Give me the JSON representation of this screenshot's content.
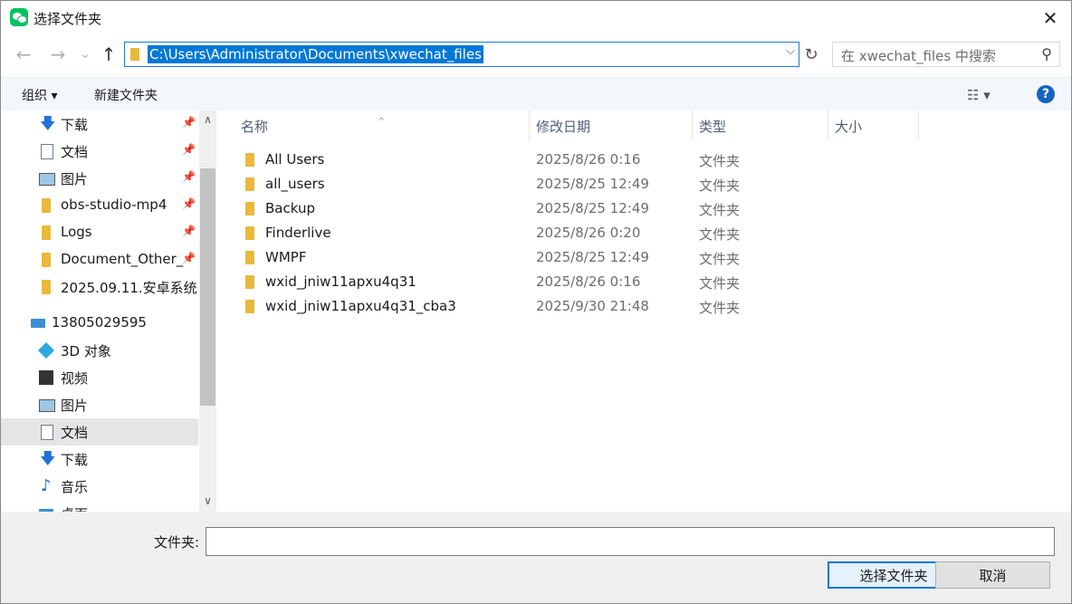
{
  "window": {
    "title": "选择文件夹",
    "close": "✕"
  },
  "nav": {
    "back": "←",
    "forward": "→",
    "recent": "⌄",
    "up": "↑"
  },
  "address": {
    "path": "C:\\Users\\Administrator\\Documents\\xwechat_files",
    "dropdown": "⌵",
    "refresh": "↻"
  },
  "search": {
    "placeholder": "在 xwechat_files 中搜索",
    "icon": "⚲"
  },
  "toolbar": {
    "organize": "组织 ▾",
    "new_folder": "新建文件夹",
    "view": "☷ ▾",
    "help": "?"
  },
  "sidebar": {
    "items": [
      {
        "label": "下载",
        "icon": "download-icon",
        "pinned": true
      },
      {
        "label": "文档",
        "icon": "document-icon",
        "pinned": true
      },
      {
        "label": "图片",
        "icon": "picture-icon",
        "pinned": true
      },
      {
        "label": "obs-studio-mp4",
        "icon": "folder-icon",
        "pinned": true
      },
      {
        "label": "Logs",
        "icon": "folder-icon",
        "pinned": true
      },
      {
        "label": "Document_Other_",
        "icon": "folder-icon",
        "pinned": true
      },
      {
        "label": "2025.09.11.安卓系统",
        "icon": "folder-icon",
        "pinned": false
      },
      {
        "label": "13805029595",
        "icon": "computer-icon",
        "pinned": false
      },
      {
        "label": "3D 对象",
        "icon": "3d-objects-icon",
        "pinned": false
      },
      {
        "label": "视频",
        "icon": "video-icon",
        "pinned": false
      },
      {
        "label": "图片",
        "icon": "picture-icon",
        "pinned": false
      },
      {
        "label": "文档",
        "icon": "document-icon",
        "pinned": false
      },
      {
        "label": "下载",
        "icon": "download-icon",
        "pinned": false
      },
      {
        "label": "音乐",
        "icon": "music-icon",
        "pinned": false
      },
      {
        "label": "桌面",
        "icon": "desktop-icon",
        "pinned": false
      }
    ],
    "pin_glyph": "📌",
    "scroll_up": "∧",
    "scroll_down": "∨"
  },
  "columns": {
    "name": "名称",
    "modified": "修改日期",
    "type": "类型",
    "size": "大小",
    "sort": "^"
  },
  "files": [
    {
      "name": "All Users",
      "date": "2025/8/26 0:16",
      "type": "文件夹"
    },
    {
      "name": "all_users",
      "date": "2025/8/25 12:49",
      "type": "文件夹"
    },
    {
      "name": "Backup",
      "date": "2025/8/25 12:49",
      "type": "文件夹"
    },
    {
      "name": "Finderlive",
      "date": "2025/8/26 0:20",
      "type": "文件夹"
    },
    {
      "name": "WMPF",
      "date": "2025/8/25 12:49",
      "type": "文件夹"
    },
    {
      "name": "wxid_jniw11apxu4q31",
      "date": "2025/8/26 0:16",
      "type": "文件夹"
    },
    {
      "name": "wxid_jniw11apxu4q31_cba3",
      "date": "2025/9/30 21:48",
      "type": "文件夹"
    }
  ],
  "footer": {
    "folder_label": "文件夹:",
    "folder_value": "",
    "select_button": "选择文件夹",
    "cancel_button": "取消"
  },
  "colors": {
    "accent": "#0078d7",
    "folder": "#eab83b",
    "toolbar_bg": "#f3f6fb",
    "footer_bg": "#f0f0f0"
  }
}
